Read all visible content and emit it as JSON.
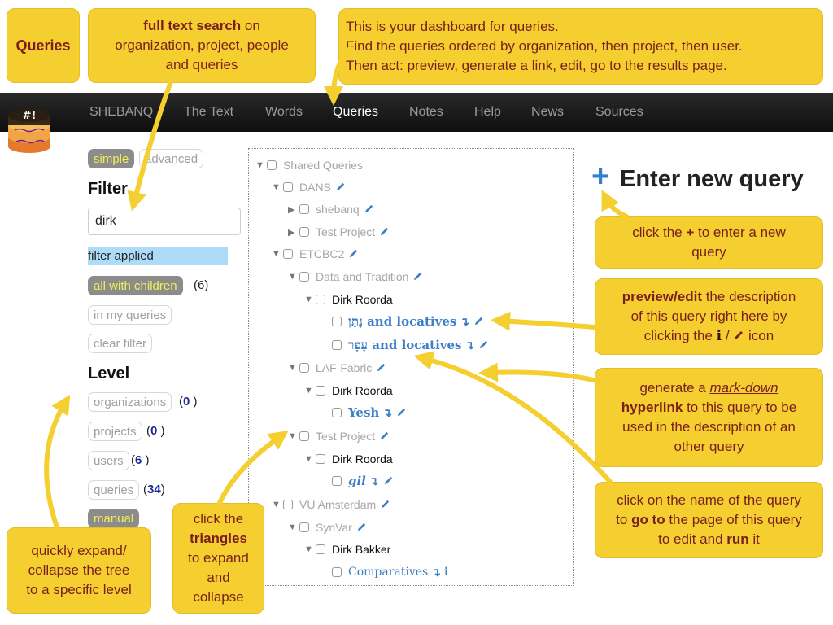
{
  "navbar": {
    "items": [
      "SHEBANQ",
      "The Text",
      "Words",
      "Queries",
      "Notes",
      "Help",
      "News",
      "Sources"
    ],
    "active": "Queries"
  },
  "logo": {
    "glyph": "#!"
  },
  "sidebar": {
    "mode_simple": "simple",
    "mode_advanced": "advanced",
    "filter_heading": "Filter",
    "filter_value": "dirk",
    "filter_status": "filter applied",
    "all_with_children": "all with children",
    "all_with_children_count": "(6)",
    "in_my_queries": "in my queries",
    "clear_filter": "clear filter",
    "level_heading": "Level",
    "levels": [
      {
        "label": "organizations",
        "count": "0"
      },
      {
        "label": "projects",
        "count": "0"
      },
      {
        "label": "users",
        "count": "6"
      },
      {
        "label": "queries",
        "count": "34"
      }
    ],
    "manual": "manual"
  },
  "tree": [
    {
      "label": "Shared Queries"
    },
    {
      "label": "DANS"
    },
    {
      "label": "shebanq"
    },
    {
      "label": "Test Project"
    },
    {
      "label": "ETCBC2"
    },
    {
      "label": "Data and Tradition"
    },
    {
      "label": "Dirk Roorda"
    },
    {
      "label": "נָתַן and locatives"
    },
    {
      "label": "עָפָר and locatives"
    },
    {
      "label": "LAF-Fabric"
    },
    {
      "label": "Dirk Roorda"
    },
    {
      "label": "Yesh"
    },
    {
      "label": "Test Project"
    },
    {
      "label": "Dirk Roorda"
    },
    {
      "label": "gil"
    },
    {
      "label": "VU Amsterdam"
    },
    {
      "label": "SynVar"
    },
    {
      "label": "Dirk Bakker"
    },
    {
      "label": "Comparatives"
    }
  ],
  "tree_link_glyph": "↴",
  "info_glyph": "i",
  "new_query": {
    "plus": "+",
    "label": "Enter new query"
  },
  "callouts": {
    "queries_title": "Queries",
    "search": {
      "bold": "full text search",
      "rest1": " on",
      "line2": "organization, project, people",
      "line3": "and queries"
    },
    "dashboard": {
      "line1": "This is your dashboard for queries.",
      "line2": "Find the queries ordered by organization, then project, then user.",
      "line3": "Then act: preview, generate a link, edit, go to the results page."
    },
    "plus": {
      "pre": "click the ",
      "bold": "+",
      "post": " to enter a new",
      "line2": "query"
    },
    "preview": {
      "bold": "preview/edit",
      "rest": " the description",
      "line2": "of this query right here by",
      "line3a": "clicking the ",
      "icon_i": "i",
      "slash": " / ",
      "line3b": " icon"
    },
    "markdown": {
      "line1a": "generate a ",
      "line1u": "mark-down",
      "line2": "hyperlink",
      "line2b": " to this query to be",
      "line3": "used in the description of an",
      "line4": "other query"
    },
    "goto": {
      "line1": "click on the name of the query",
      "line2a": "to ",
      "line2b": "go to",
      "line2c": " the page of this query",
      "line3a": "to edit and ",
      "line3b": "run",
      "line3c": " it"
    },
    "level": {
      "line1": "quickly expand/",
      "line2": "collapse the tree",
      "line3": "to a specific level"
    },
    "triangles": {
      "line1": "click the",
      "line2": "triangles",
      "line3": "to expand",
      "line4": "and",
      "line5": "collapse"
    }
  },
  "colors": {
    "callout": "#f4cf2f",
    "callout_text": "#7a1e1e",
    "link": "#3d7fc4",
    "navbar": "#1a1a1a"
  }
}
